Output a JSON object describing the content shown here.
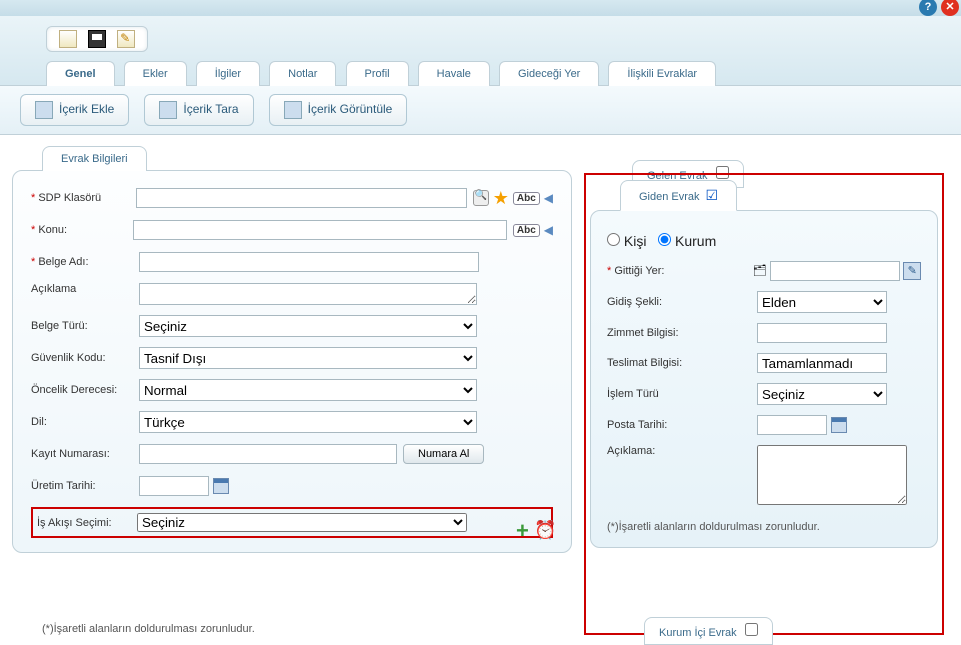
{
  "tabs": {
    "genel": "Genel",
    "ekler": "Ekler",
    "ilgiler": "İlgiler",
    "notlar": "Notlar",
    "profil": "Profil",
    "havale": "Havale",
    "gidecegi_yer": "Gideceği Yer",
    "iliskili_evraklar": "İlişkili Evraklar"
  },
  "actions": {
    "icerik_ekle": "İçerik Ekle",
    "icerik_tara": "İçerik Tara",
    "icerik_goruntule": "İçerik Görüntüle"
  },
  "left": {
    "title": "Evrak Bilgileri",
    "labels": {
      "sdp": "SDP Klasörü",
      "konu": "Konu:",
      "belge_adi": "Belge Adı:",
      "aciklama": "Açıklama",
      "belge_turu": "Belge Türü:",
      "guvenlik": "Güvenlik Kodu:",
      "oncelik": "Öncelik Derecesi:",
      "dil": "Dil:",
      "kayit_no": "Kayıt Numarası:",
      "uretim": "Üretim Tarihi:",
      "is_akisi": "İş Akışı Seçimi:"
    },
    "values": {
      "belge_turu": "Seçiniz",
      "guvenlik": "Tasnif Dışı",
      "oncelik": "Normal",
      "dil": "Türkçe",
      "is_akisi": "Seçiniz"
    },
    "numara_al": "Numara Al",
    "abc": "Abc",
    "footer": "(*)İşaretli alanların doldurulması zorunludur."
  },
  "right": {
    "gelen": "Gelen Evrak",
    "giden": "Giden Evrak",
    "kurum_ici": "Kurum İçi Evrak",
    "radio_kisi": "Kişi",
    "radio_kurum": "Kurum",
    "labels": {
      "gittigi": "Gittiği Yer:",
      "gidis": "Gidiş Şekli:",
      "zimmet": "Zimmet Bilgisi:",
      "teslimat": "Teslimat Bilgisi:",
      "islem": "İşlem Türü",
      "posta": "Posta Tarihi:",
      "aciklama": "Açıklama:"
    },
    "values": {
      "gidis": "Elden",
      "teslimat": "Tamamlanmadı",
      "islem": "Seçiniz"
    },
    "footer": "(*)İşaretli alanların doldurulması zorunludur."
  }
}
